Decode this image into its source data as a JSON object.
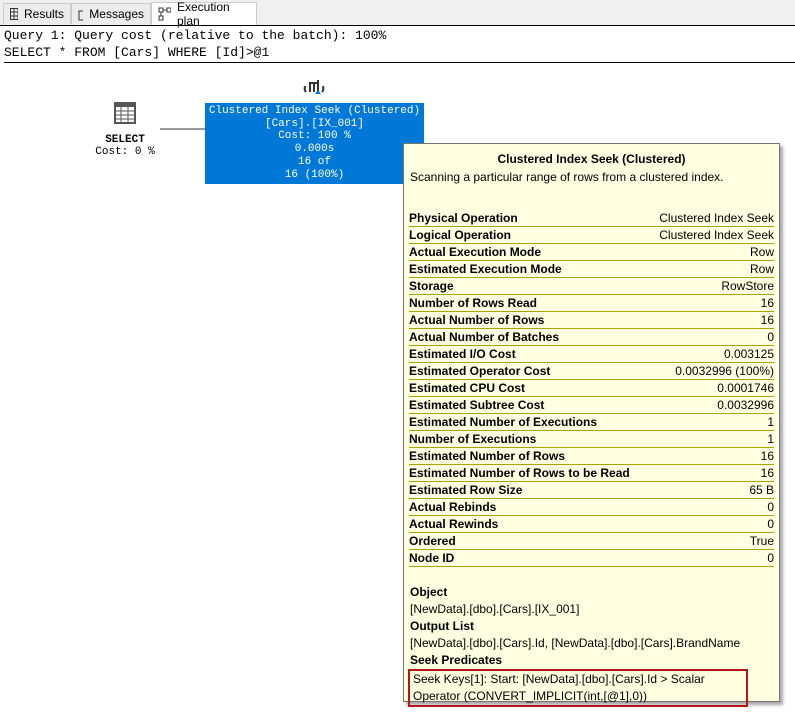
{
  "tabs": [
    {
      "label": "Results",
      "icon": "grid-icon"
    },
    {
      "label": "Messages",
      "icon": "messages-icon"
    },
    {
      "label": "Execution plan",
      "icon": "plan-icon",
      "active": true
    }
  ],
  "header": {
    "cost_line": "Query 1: Query cost (relative to the batch): 100%",
    "query": "SELECT * FROM [Cars] WHERE [Id]>@1"
  },
  "select_node": {
    "label": "SELECT",
    "cost": "Cost: 0 %"
  },
  "seek_node": {
    "lines": [
      "Clustered Index Seek (Clustered)",
      "[Cars].[IX_001]",
      "Cost: 100 %",
      "0.000s",
      "16 of",
      "16 (100%)"
    ]
  },
  "tooltip": {
    "title": "Clustered Index Seek (Clustered)",
    "description": "Scanning a particular range of rows from a clustered index.",
    "rows": [
      [
        "Physical Operation",
        "Clustered Index Seek"
      ],
      [
        "Logical Operation",
        "Clustered Index Seek"
      ],
      [
        "Actual Execution Mode",
        "Row"
      ],
      [
        "Estimated Execution Mode",
        "Row"
      ],
      [
        "Storage",
        "RowStore"
      ],
      [
        "Number of Rows Read",
        "16"
      ],
      [
        "Actual Number of Rows",
        "16"
      ],
      [
        "Actual Number of Batches",
        "0"
      ],
      [
        "Estimated I/O Cost",
        "0.003125"
      ],
      [
        "Estimated Operator Cost",
        "0.0032996 (100%)"
      ],
      [
        "Estimated CPU Cost",
        "0.0001746"
      ],
      [
        "Estimated Subtree Cost",
        "0.0032996"
      ],
      [
        "Estimated Number of Executions",
        "1"
      ],
      [
        "Number of Executions",
        "1"
      ],
      [
        "Estimated Number of Rows",
        "16"
      ],
      [
        "Estimated Number of Rows to be Read",
        "16"
      ],
      [
        "Estimated Row Size",
        "65 B"
      ],
      [
        "Actual Rebinds",
        "0"
      ],
      [
        "Actual Rewinds",
        "0"
      ],
      [
        "Ordered",
        "True"
      ],
      [
        "Node ID",
        "0"
      ]
    ],
    "object_label": "Object",
    "object": "[NewData].[dbo].[Cars].[IX_001]",
    "output_label": "Output List",
    "output": "[NewData].[dbo].[Cars].Id, [NewData].[dbo].[Cars].BrandName",
    "seek_label": "Seek Predicates",
    "seek": "Seek Keys[1]: Start: [NewData].[dbo].[Cars].Id > Scalar Operator (CONVERT_IMPLICIT(int,[@1],0))"
  },
  "colors": {
    "node": "#0078d7",
    "tooltip_bg": "#ffffe1",
    "highlight": "#b01818"
  }
}
